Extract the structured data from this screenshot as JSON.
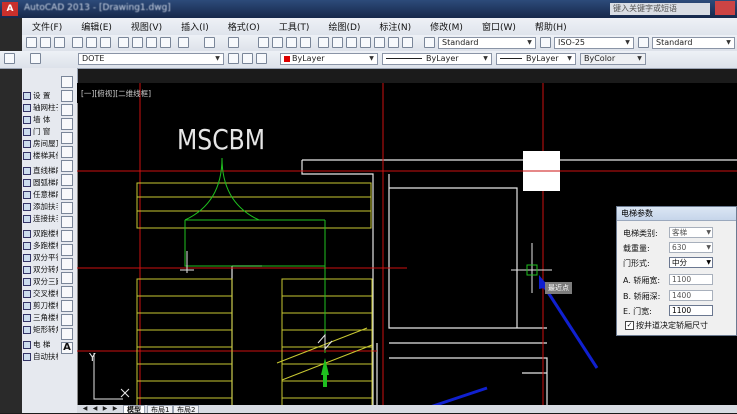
{
  "app": {
    "title": "AutoCAD 2013 - [Drawing1.dwg]",
    "icon_label": "A",
    "search_placeholder": "键入关键字或短语"
  },
  "menu": [
    "文件(F)",
    "编辑(E)",
    "视图(V)",
    "插入(I)",
    "格式(O)",
    "工具(T)",
    "绘图(D)",
    "标注(N)",
    "修改(M)",
    "窗口(W)",
    "帮助(H)"
  ],
  "toolbar": {
    "text_style": "Standard",
    "dim_style": "ISO-25",
    "table_style": "Standard"
  },
  "properties": {
    "layer": "DOTE",
    "color": "ByLayer",
    "linetype": "ByLayer",
    "lineweight": "ByLayer",
    "plotstyle": "ByColor",
    "color_swatch": "#dd0000"
  },
  "palette_items": [
    "设 置",
    "轴网柱子",
    "墙   体",
    "门   窗",
    "房间屋顶",
    "楼梯其他",
    "直线梯段",
    "圆弧梯段",
    "任意梯段",
    "添加扶手",
    "连接扶手",
    "双跑楼梯",
    "多跑楼梯",
    "双分平行",
    "双分转角",
    "双分三跑",
    "交叉楼梯",
    "剪刀楼梯",
    "三角楼梯",
    "矩形转角",
    "电   梯",
    "自动扶梯"
  ],
  "viewport_label": "[一][俯视][二维线框]",
  "drawing": {
    "block_text": "MSCBM",
    "tooltip": "最近点",
    "ucs_y": "Y",
    "ucs_x": "X"
  },
  "dialog": {
    "title": "电梯参数",
    "fields": [
      {
        "label": "电梯类别:",
        "value": "客梯",
        "type": "select",
        "enabled": false
      },
      {
        "label": "载重量:",
        "value": "630",
        "type": "select",
        "enabled": false
      },
      {
        "label": "门形式:",
        "value": "中分",
        "type": "select",
        "enabled": true
      },
      {
        "label": "A. 轿厢宽:",
        "value": "1100",
        "type": "input",
        "enabled": false
      },
      {
        "label": "B. 轿厢深:",
        "value": "1400",
        "type": "input",
        "enabled": false
      },
      {
        "label": "E. 门宽:",
        "value": "1100",
        "type": "input",
        "enabled": true
      }
    ],
    "checkbox_label": "按井道决定轿厢尺寸",
    "checkbox_checked": true
  },
  "layout_tabs": [
    "模型",
    "布局1",
    "布局2"
  ],
  "colors": {
    "canvas_bg": "#000000",
    "red_line": "#cc1111",
    "yellow_line": "#c8c832",
    "green_line": "#1fbf1f",
    "white_line": "#e6e6e6",
    "annotation_arrow": "#1020d0"
  }
}
